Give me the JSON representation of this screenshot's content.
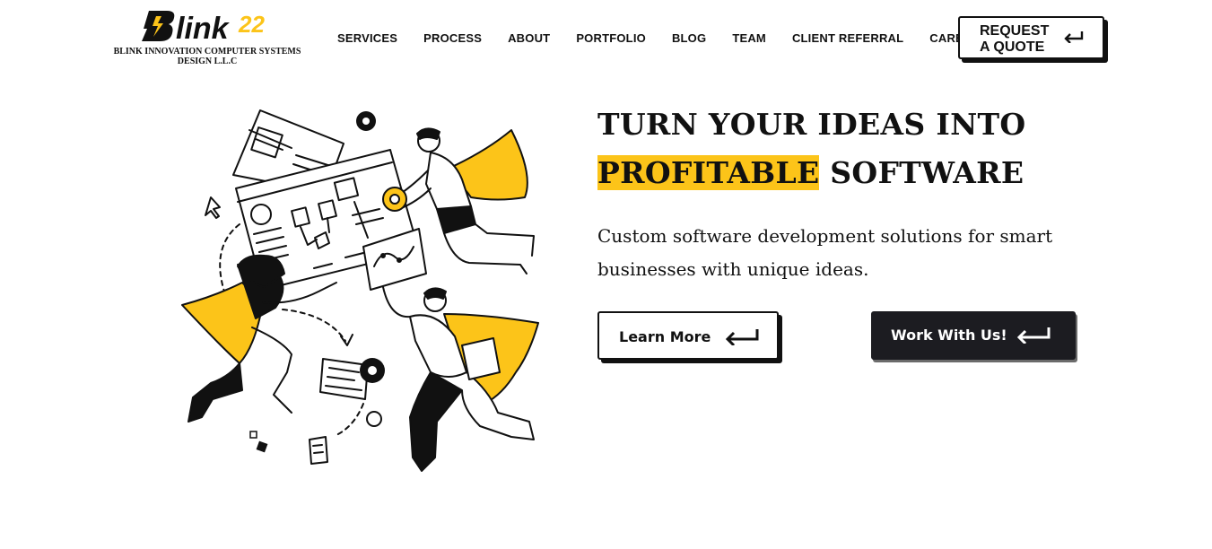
{
  "brand": {
    "logo_text": "Blink22",
    "tagline": "BLINK INNOVATION COMPUTER SYSTEMS DESIGN L.L.C",
    "accent_color": "#fcc419",
    "dark_color": "#1c1c21"
  },
  "nav": {
    "items": [
      {
        "label": "SERVICES"
      },
      {
        "label": "PROCESS"
      },
      {
        "label": "ABOUT"
      },
      {
        "label": "PORTFOLIO"
      },
      {
        "label": "BLOG"
      },
      {
        "label": "TEAM"
      },
      {
        "label": "CLIENT REFERRAL"
      },
      {
        "label": "CAREERS"
      }
    ],
    "quote_button": {
      "label": "REQUEST A QUOTE",
      "icon": "enter-arrow-icon"
    }
  },
  "hero": {
    "headline_line1": "TURN YOUR IDEAS INTO",
    "headline_highlight": "PROFITABLE",
    "headline_rest": "SOFTWARE",
    "subtext": "Custom software development solutions for smart businesses with unique ideas.",
    "illustration": "team-building-software-illustration",
    "buttons": {
      "learn_more": {
        "label": "Learn More",
        "icon": "enter-arrow-icon"
      },
      "work_with_us": {
        "label": "Work With Us!",
        "icon": "enter-arrow-icon"
      }
    }
  }
}
